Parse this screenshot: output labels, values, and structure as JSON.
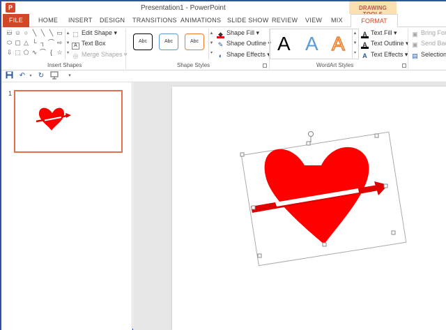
{
  "window": {
    "app_icon": "P",
    "title": "Presentation1 - PowerPoint",
    "contextual_group": "DRAWING TOOLS"
  },
  "tabs": [
    "FILE",
    "HOME",
    "INSERT",
    "DESIGN",
    "TRANSITIONS",
    "ANIMATIONS",
    "SLIDE SHOW",
    "REVIEW",
    "VIEW",
    "MIX",
    "FORMAT"
  ],
  "ribbon": {
    "insert_shapes": {
      "label": "Insert Shapes",
      "edit_shape": "Edit Shape",
      "text_box": "Text Box",
      "merge_shapes": "Merge Shapes"
    },
    "shape_styles": {
      "label": "Shape Styles",
      "swatches": [
        "Abc",
        "Abc",
        "Abc"
      ],
      "swatch_colors": [
        "#000000",
        "#5b9bd5",
        "#ed7d31"
      ],
      "shape_fill": "Shape Fill",
      "shape_outline": "Shape Outline",
      "shape_effects": "Shape Effects",
      "fill_color": "#ff0000"
    },
    "wordart_styles": {
      "label": "WordArt Styles",
      "letters": [
        "A",
        "A",
        "A"
      ],
      "text_fill": "Text Fill",
      "text_outline": "Text Outline",
      "text_effects": "Text Effects"
    },
    "arrange": {
      "bring_forward": "Bring For",
      "send_backward": "Send Bac",
      "selection_pane": "Selection"
    }
  },
  "quick_access": {
    "icons": [
      "save-icon",
      "undo-icon",
      "redo-icon",
      "start-from-beginning-icon",
      "customize-icon"
    ]
  },
  "slides_pane": {
    "slide_number": "1"
  },
  "colors": {
    "accent": "#d24726",
    "heart": "#ff0000",
    "contextual_band": "#fbe1b0"
  }
}
